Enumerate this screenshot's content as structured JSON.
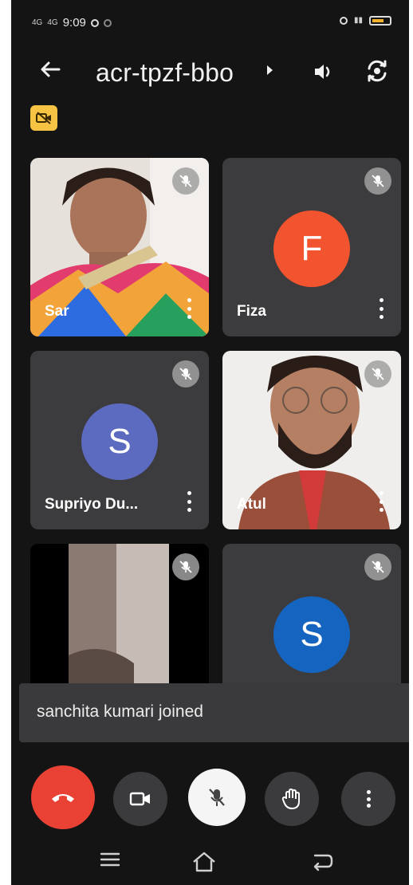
{
  "status_bar": {
    "signal_1": "4G",
    "signal_2": "4G",
    "time": "9:09",
    "battery_level": "60%"
  },
  "meeting": {
    "code": "acr-tpzf-bbo",
    "back_icon": "arrow-left-icon",
    "audio_icon": "speaker-icon",
    "switch_camera_icon": "camera-flip-icon",
    "camera_off_badge_icon": "video-off-icon"
  },
  "participants": [
    {
      "name": "Sar",
      "type": "video",
      "muted": true
    },
    {
      "name": "Fiza",
      "type": "avatar",
      "initial": "F",
      "avatar_color": "#f1542f",
      "muted": true
    },
    {
      "name": "Supriyo Du...",
      "type": "avatar",
      "initial": "S",
      "avatar_color": "#5c6bc0",
      "muted": true
    },
    {
      "name": "Atul",
      "type": "video",
      "muted": true
    },
    {
      "name": "",
      "type": "video",
      "muted": true
    },
    {
      "name": "",
      "type": "avatar",
      "initial": "S",
      "avatar_color": "#1565c0",
      "muted": true
    }
  ],
  "toast": {
    "message": "sanchita kumari joined"
  },
  "controls": {
    "end_call_icon": "phone-hangup-icon",
    "camera_icon": "video-camera-icon",
    "mic_icon": "mic-off-icon",
    "raise_hand_icon": "hand-icon",
    "more_icon": "more-vertical-icon"
  },
  "nav_bar": {
    "menu_icon": "menu-icon",
    "home_icon": "home-icon",
    "back_icon": "back-icon"
  },
  "colors": {
    "background": "#141414",
    "tile": "#3c3c3e",
    "end_call": "#e94235",
    "camera_badge": "#f6c343"
  }
}
